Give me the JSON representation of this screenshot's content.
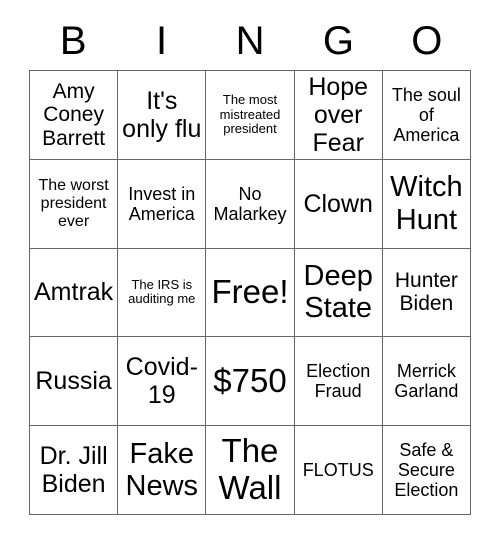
{
  "header": {
    "letters": [
      "B",
      "I",
      "N",
      "G",
      "O"
    ]
  },
  "grid": {
    "rows": [
      {
        "cells": [
          {
            "text": "Amy Coney Barrett",
            "size": "lg"
          },
          {
            "text": "It's only flu",
            "size": "xl"
          },
          {
            "text": "The most mistreated president",
            "size": "xs"
          },
          {
            "text": "Hope over Fear",
            "size": "xl"
          },
          {
            "text": "The soul of America",
            "size": "md"
          }
        ]
      },
      {
        "cells": [
          {
            "text": "The worst president ever",
            "size": "sm"
          },
          {
            "text": "Invest in America",
            "size": "md"
          },
          {
            "text": "No Malarkey",
            "size": "md"
          },
          {
            "text": "Clown",
            "size": "xl"
          },
          {
            "text": "Witch Hunt",
            "size": "xxl"
          }
        ]
      },
      {
        "cells": [
          {
            "text": "Amtrak",
            "size": "xl"
          },
          {
            "text": "The IRS is auditing me",
            "size": "xs"
          },
          {
            "text": "Free!",
            "size": "max"
          },
          {
            "text": "Deep State",
            "size": "xxl"
          },
          {
            "text": "Hunter Biden",
            "size": "lg"
          }
        ]
      },
      {
        "cells": [
          {
            "text": "Russia",
            "size": "xl"
          },
          {
            "text": "Covid-19",
            "size": "xl"
          },
          {
            "text": "$750",
            "size": "max"
          },
          {
            "text": "Election Fraud",
            "size": "md"
          },
          {
            "text": "Merrick Garland",
            "size": "md"
          }
        ]
      },
      {
        "cells": [
          {
            "text": "Dr. Jill Biden",
            "size": "xl"
          },
          {
            "text": "Fake News",
            "size": "xxl"
          },
          {
            "text": "The Wall",
            "size": "max"
          },
          {
            "text": "FLOTUS",
            "size": "md"
          },
          {
            "text": "Safe & Secure Election",
            "size": "md"
          }
        ]
      }
    ]
  },
  "style": {
    "background_color": "#ffffff",
    "text_color": "#000000",
    "grid_line_color": "#666666"
  }
}
